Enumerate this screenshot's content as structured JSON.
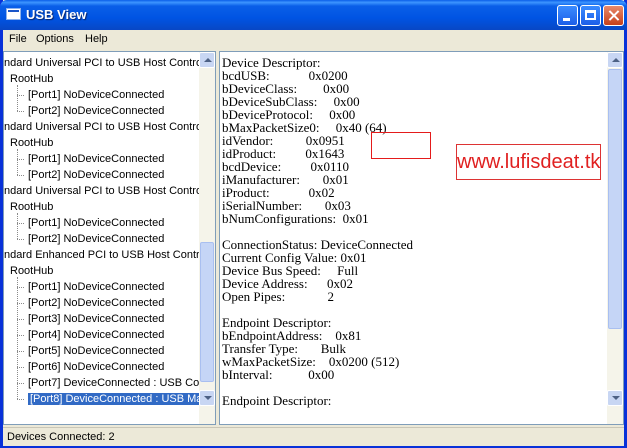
{
  "window": {
    "title": "USB View"
  },
  "menu": [
    {
      "label": "File"
    },
    {
      "label": "Options"
    },
    {
      "label": "Help"
    }
  ],
  "tree": [
    {
      "text": "ndard Universal PCI to USB Host Contro",
      "level": 0
    },
    {
      "text": "RootHub",
      "level": 1
    },
    {
      "text": "[Port1] NoDeviceConnected",
      "level": 2
    },
    {
      "text": "[Port2] NoDeviceConnected",
      "level": 2
    },
    {
      "text": "ndard Universal PCI to USB Host Contro",
      "level": 0
    },
    {
      "text": "RootHub",
      "level": 1
    },
    {
      "text": "[Port1] NoDeviceConnected",
      "level": 2
    },
    {
      "text": "[Port2] NoDeviceConnected",
      "level": 2
    },
    {
      "text": "ndard Universal PCI to USB Host Contro",
      "level": 0
    },
    {
      "text": "RootHub",
      "level": 1
    },
    {
      "text": "[Port1] NoDeviceConnected",
      "level": 2
    },
    {
      "text": "[Port2] NoDeviceConnected",
      "level": 2
    },
    {
      "text": "ndard Enhanced PCI to USB Host Contro",
      "level": 0
    },
    {
      "text": "RootHub",
      "level": 1
    },
    {
      "text": "[Port1] NoDeviceConnected",
      "level": 2
    },
    {
      "text": "[Port2] NoDeviceConnected",
      "level": 2
    },
    {
      "text": "[Port3] NoDeviceConnected",
      "level": 2
    },
    {
      "text": "[Port4] NoDeviceConnected",
      "level": 2
    },
    {
      "text": "[Port5] NoDeviceConnected",
      "level": 2
    },
    {
      "text": "[Port6] NoDeviceConnected",
      "level": 2
    },
    {
      "text": "[Port7] DeviceConnected :  USB Co",
      "level": 2
    },
    {
      "text": "[Port8] DeviceConnected :  USB Ma",
      "level": 2,
      "selected": true
    }
  ],
  "details": [
    "Device Descriptor:",
    "bcdUSB:            0x0200",
    "bDeviceClass:        0x00",
    "bDeviceSubClass:     0x00",
    "bDeviceProtocol:     0x00",
    "bMaxPacketSize0:     0x40 (64)",
    "idVendor:          0x0951",
    "idProduct:         0x1643",
    "bcdDevice:         0x0110",
    "iManufacturer:       0x01",
    "iProduct:            0x02",
    "iSerialNumber:       0x03",
    "bNumConfigurations:  0x01",
    "",
    "ConnectionStatus: DeviceConnected",
    "Current Config Value: 0x01",
    "Device Bus Speed:     Full",
    "Device Address:      0x02",
    "Open Pipes:             2",
    "",
    "Endpoint Descriptor:",
    "bEndpointAddress:    0x81",
    "Transfer Type:       Bulk",
    "wMaxPacketSize:    0x0200 (512)",
    "bInterval:           0x00",
    "",
    "Endpoint Descriptor:"
  ],
  "watermark": "www.lufisdeat.tk",
  "status": {
    "text": "Devices Connected: 2"
  },
  "colors": {
    "selection": "#316ac5",
    "highlight_red": "#e41b1b",
    "titlebar": "#0054e3"
  },
  "left_scroll": {
    "position": 0.55
  },
  "right_scroll": {
    "position": 0.0
  }
}
